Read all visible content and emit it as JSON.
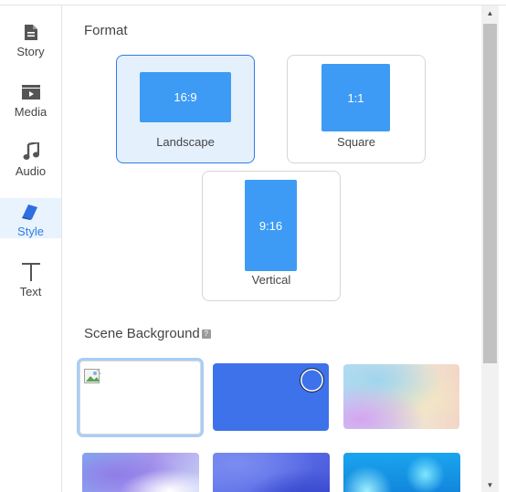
{
  "sidebar": {
    "items": [
      {
        "label": "Story",
        "icon": "document-icon",
        "active": false
      },
      {
        "label": "Media",
        "icon": "media-icon",
        "active": false
      },
      {
        "label": "Audio",
        "icon": "music-note-icon",
        "active": false
      },
      {
        "label": "Style",
        "icon": "paint-brush-icon",
        "active": true
      },
      {
        "label": "Text",
        "icon": "text-t-icon",
        "active": false
      }
    ]
  },
  "format": {
    "title": "Format",
    "options": [
      {
        "ratio": "16:9",
        "label": "Landscape",
        "selected": true
      },
      {
        "ratio": "1:1",
        "label": "Square",
        "selected": false
      },
      {
        "ratio": "9:16",
        "label": "Vertical",
        "selected": false
      }
    ]
  },
  "scene_background": {
    "title": "Scene Background",
    "help_icon": "?",
    "tiles": [
      {
        "name": "blank-image",
        "selected": true
      },
      {
        "name": "solid-blue",
        "color": "#3d72ea",
        "selected": false
      },
      {
        "name": "pastel-gradient",
        "selected": false
      },
      {
        "name": "blue-purple-gradient",
        "selected": false
      },
      {
        "name": "indigo-waves",
        "selected": false
      },
      {
        "name": "cyan-pattern",
        "selected": false
      }
    ]
  },
  "colors": {
    "accent": "#2f7de1",
    "ratio_fill": "#3d9bf5",
    "selected_bg": "#e5f0fd"
  },
  "scrollbar": {
    "up": "▲",
    "down": "▼"
  }
}
